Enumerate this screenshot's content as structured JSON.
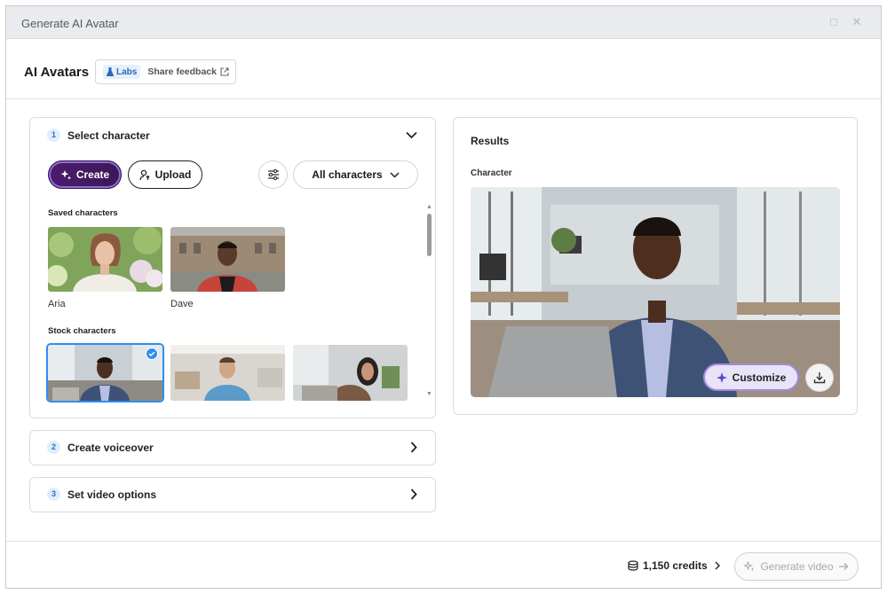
{
  "window": {
    "title": "Generate AI Avatar"
  },
  "header": {
    "title": "AI Avatars",
    "labs_badge": "Labs",
    "feedback_label": "Share feedback"
  },
  "steps": [
    {
      "number": "1",
      "title": "Select character",
      "expanded": true
    },
    {
      "number": "2",
      "title": "Create voiceover",
      "expanded": false
    },
    {
      "number": "3",
      "title": "Set video options",
      "expanded": false
    }
  ],
  "select_character": {
    "create_label": "Create",
    "upload_label": "Upload",
    "filter_label": "All characters",
    "saved_label": "Saved characters",
    "saved": [
      {
        "name": "Aria"
      },
      {
        "name": "Dave"
      }
    ],
    "stock_label": "Stock characters",
    "stock_selected_index": 0
  },
  "results": {
    "title": "Results",
    "character_label": "Character",
    "customize_label": "Customize"
  },
  "footer": {
    "credits": "1,150 credits",
    "generate_label": "Generate video"
  },
  "colors": {
    "accent": "#2f8df0",
    "create_bg": "#4d1b6e",
    "customize_border": "#a08ae0"
  }
}
